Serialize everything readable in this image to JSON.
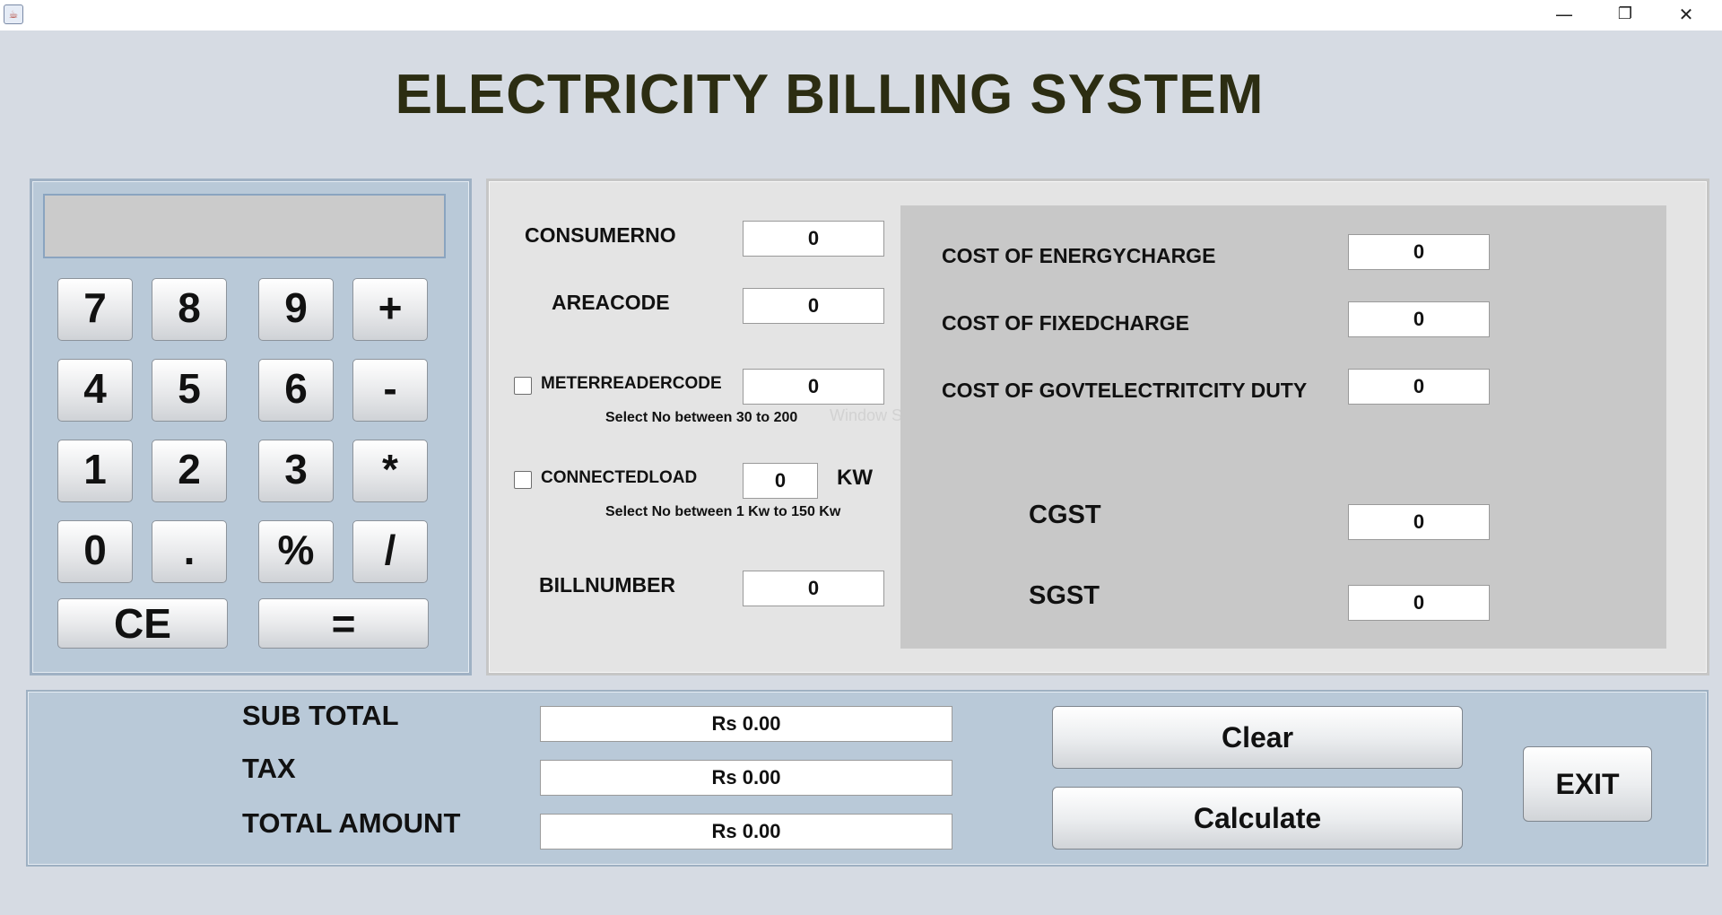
{
  "window": {
    "title": "",
    "minimize": "—",
    "restore": "❐",
    "close": "✕"
  },
  "app_title": "ELECTRICITY BILLING SYSTEM",
  "calculator": {
    "display": "",
    "keys": [
      "7",
      "8",
      "9",
      "+",
      "4",
      "5",
      "6",
      "-",
      "1",
      "2",
      "3",
      "*",
      "0",
      ".",
      "%",
      "/"
    ],
    "ce": "CE",
    "equals": "="
  },
  "form": {
    "consumer_no": {
      "label": "CONSUMERNO",
      "value": "0"
    },
    "area_code": {
      "label": "AREACODE",
      "value": "0"
    },
    "meter_reader_code": {
      "label": "METERREADERCODE",
      "value": "0",
      "checked": false,
      "hint": "Select No between 30 to 200"
    },
    "connected_load": {
      "label": "CONNECTEDLOAD",
      "value": "0",
      "unit": "KW",
      "checked": false,
      "hint": "Select No between 1 Kw to 150 Kw"
    },
    "bill_number": {
      "label": "BILLNUMBER",
      "value": "0"
    },
    "ghost_text": "Window Snip"
  },
  "costs": {
    "energy_charge": {
      "label": "COST OF ENERGYCHARGE",
      "value": "0"
    },
    "fixed_charge": {
      "label": "COST OF FIXEDCHARGE",
      "value": "0"
    },
    "govt_duty": {
      "label": "COST OF GOVTELECTRITCITY DUTY",
      "value": "0"
    },
    "cgst": {
      "label": "CGST",
      "value": "0"
    },
    "sgst": {
      "label": "SGST",
      "value": "0"
    }
  },
  "totals": {
    "sub_total": {
      "label": "SUB TOTAL",
      "value": "Rs 0.00"
    },
    "tax": {
      "label": "TAX",
      "value": "Rs 0.00"
    },
    "total_amount": {
      "label": "TOTAL AMOUNT",
      "value": "Rs 0.00"
    }
  },
  "buttons": {
    "clear": "Clear",
    "calculate": "Calculate",
    "exit": "EXIT"
  }
}
